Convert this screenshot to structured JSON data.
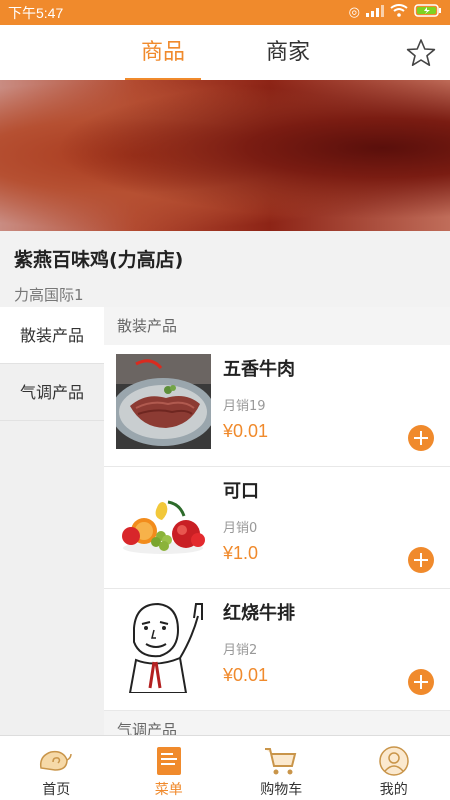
{
  "status_bar": {
    "time": "下午5:47",
    "icons": [
      "alarm-icon",
      "signal-icon",
      "wifi-icon",
      "battery-charging-icon"
    ]
  },
  "top_nav": {
    "tabs": [
      {
        "label": "商品",
        "active": true
      },
      {
        "label": "商家",
        "active": false
      }
    ],
    "favorite_icon": "star-outline-icon"
  },
  "shop": {
    "name": "紫燕百味鸡(力高店)",
    "address": "力高国际1"
  },
  "categories": [
    {
      "label": "散装产品",
      "active": true
    },
    {
      "label": "气调产品",
      "active": false
    }
  ],
  "sections": [
    {
      "title": "散装产品",
      "items": [
        {
          "name": "五香牛肉",
          "sales": "月销19",
          "price": "¥0.01",
          "image": "sliced-beef-plate"
        },
        {
          "name": "可口",
          "sales": "月销0",
          "price": "¥1.0",
          "image": "fruit-assortment"
        },
        {
          "name": "红烧牛排",
          "sales": "月销2",
          "price": "¥0.01",
          "image": "meme-face-drawing"
        }
      ]
    },
    {
      "title": "气调产品"
    }
  ],
  "bottom_nav": [
    {
      "label": "首页",
      "icon": "home-snail-icon",
      "active": false
    },
    {
      "label": "菜单",
      "icon": "menu-document-icon",
      "active": true
    },
    {
      "label": "购物车",
      "icon": "shopping-cart-icon",
      "active": false
    },
    {
      "label": "我的",
      "icon": "user-profile-icon",
      "active": false
    }
  ],
  "colors": {
    "accent": "#f08a2c",
    "price": "#f08a2c"
  }
}
